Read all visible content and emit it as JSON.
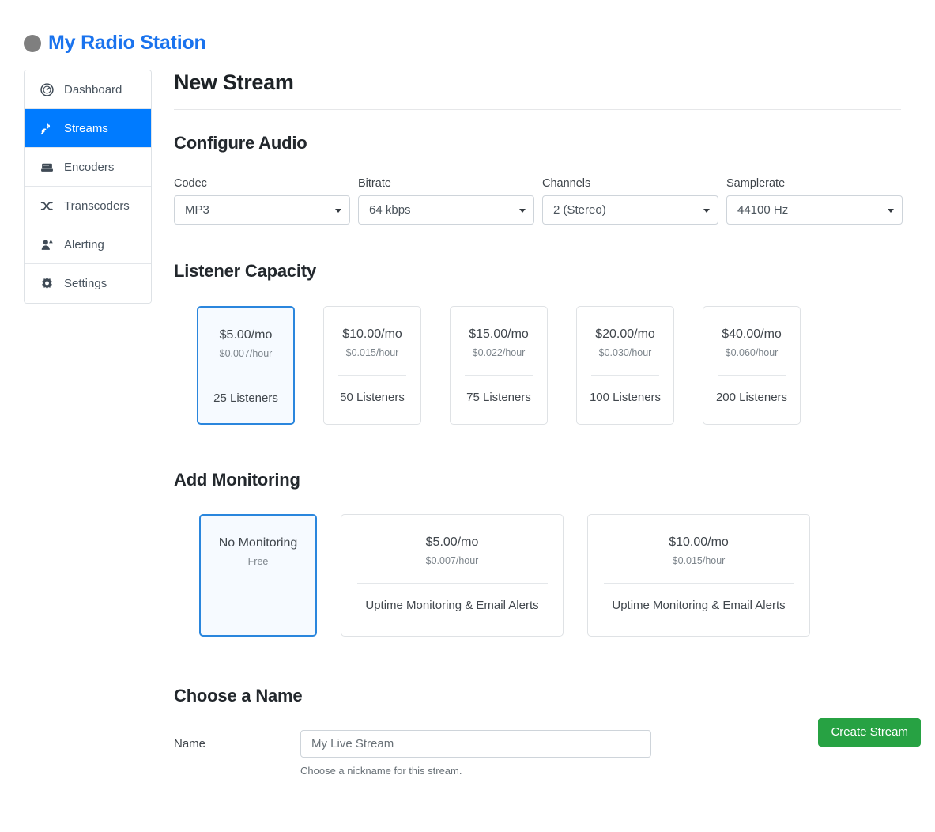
{
  "brand": {
    "logo_icon": "circle-logo",
    "title": "My Radio Station",
    "title_color": "#1a73ee"
  },
  "sidebar": {
    "items": [
      {
        "label": "Dashboard",
        "icon": "dashboard-gauge-icon",
        "active": false
      },
      {
        "label": "Streams",
        "icon": "satellite-dish-icon",
        "active": true
      },
      {
        "label": "Encoders",
        "icon": "server-icon",
        "active": false
      },
      {
        "label": "Transcoders",
        "icon": "shuffle-icon",
        "active": false
      },
      {
        "label": "Alerting",
        "icon": "user-alert-icon",
        "active": false
      },
      {
        "label": "Settings",
        "icon": "gear-icon",
        "active": false
      }
    ],
    "active_color": "#007bff"
  },
  "main": {
    "page_title": "New Stream",
    "sections": {
      "audio": {
        "heading": "Configure Audio",
        "fields": [
          {
            "label": "Codec",
            "value": "MP3"
          },
          {
            "label": "Bitrate",
            "value": "64 kbps"
          },
          {
            "label": "Channels",
            "value": "2 (Stereo)"
          },
          {
            "label": "Samplerate",
            "value": "44100 Hz"
          }
        ]
      },
      "capacity": {
        "heading": "Listener Capacity",
        "cards": [
          {
            "price": "$5.00/mo",
            "rate": "$0.007/hour",
            "feature": "25 Listeners",
            "selected": true
          },
          {
            "price": "$10.00/mo",
            "rate": "$0.015/hour",
            "feature": "50 Listeners",
            "selected": false
          },
          {
            "price": "$15.00/mo",
            "rate": "$0.022/hour",
            "feature": "75 Listeners",
            "selected": false
          },
          {
            "price": "$20.00/mo",
            "rate": "$0.030/hour",
            "feature": "100 Listeners",
            "selected": false
          },
          {
            "price": "$40.00/mo",
            "rate": "$0.060/hour",
            "feature": "200 Listeners",
            "selected": false
          }
        ]
      },
      "monitoring": {
        "heading": "Add Monitoring",
        "cards": [
          {
            "price": "No Monitoring",
            "rate": "Free",
            "feature": "",
            "selected": true
          },
          {
            "price": "$5.00/mo",
            "rate": "$0.007/hour",
            "feature": "Uptime Monitoring & Email Alerts",
            "selected": false
          },
          {
            "price": "$10.00/mo",
            "rate": "$0.015/hour",
            "feature": "Uptime Monitoring & Email Alerts",
            "selected": false
          }
        ]
      },
      "name": {
        "heading": "Choose a Name",
        "field_label": "Name",
        "input_value": "My Live Stream",
        "help_text": "Choose a nickname for this stream."
      }
    },
    "submit_label": "Create Stream",
    "submit_color": "#27a243"
  }
}
